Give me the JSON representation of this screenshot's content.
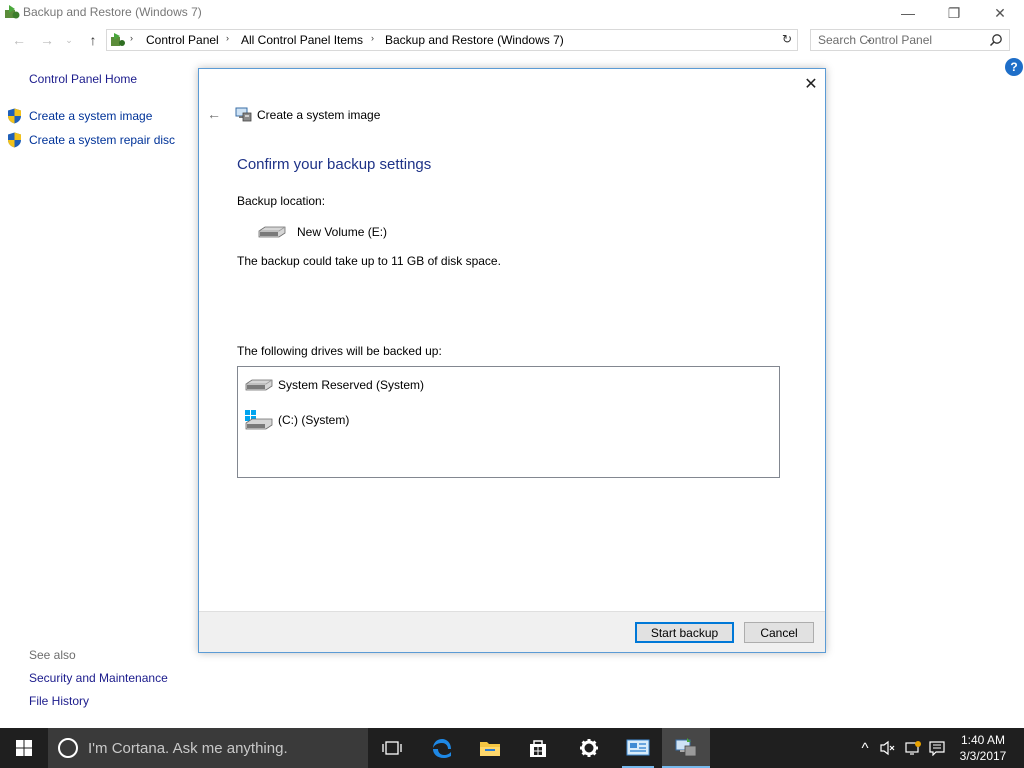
{
  "window": {
    "title": "Backup and Restore (Windows 7)",
    "minimize_glyph": "—",
    "maximize_glyph": "❐",
    "close_glyph": "✕"
  },
  "nav": {
    "back_glyph": "←",
    "forward_glyph": "→",
    "recent_glyph": "⌄",
    "up_glyph": "↑",
    "breadcrumb": [
      "Control Panel",
      "All Control Panel Items",
      "Backup and Restore (Windows 7)"
    ],
    "crumb_separator": "›",
    "dropdown_glyph": "⌄",
    "refresh_glyph": "↻",
    "search_placeholder": "Search Control Panel"
  },
  "left_pane": {
    "home": "Control Panel Home",
    "tasks": [
      "Create a system image",
      "Create a system repair disc"
    ],
    "see_also_label": "See also",
    "see_also": [
      "Security and Maintenance",
      "File History"
    ],
    "help_glyph": "?"
  },
  "dialog": {
    "close_glyph": "✕",
    "back_glyph": "←",
    "wizard_title": "Create a system image",
    "heading": "Confirm your backup settings",
    "backup_location_label": "Backup location:",
    "backup_location": "New Volume (E:)",
    "space_note": "The backup could take up to 11 GB of disk space.",
    "drives_label": "The following drives will be backed up:",
    "drives": [
      "System Reserved (System)",
      "(C:) (System)"
    ],
    "start_button": "Start backup",
    "cancel_button": "Cancel"
  },
  "taskbar": {
    "cortana_text": "I'm Cortana. Ask me anything.",
    "tray_chevron": "^",
    "clock_time": "1:40 AM",
    "clock_date": "3/3/2017"
  },
  "colors": {
    "accent": "#0078d7",
    "heading": "#1e3287",
    "link": "#003399",
    "taskbar": "#1f1f1f"
  },
  "icons": {
    "app": "backup-restore-icon",
    "dialog_wizard": "system-image-icon",
    "drive": "hard-drive-icon",
    "system_drive": "windows-drive-icon"
  }
}
